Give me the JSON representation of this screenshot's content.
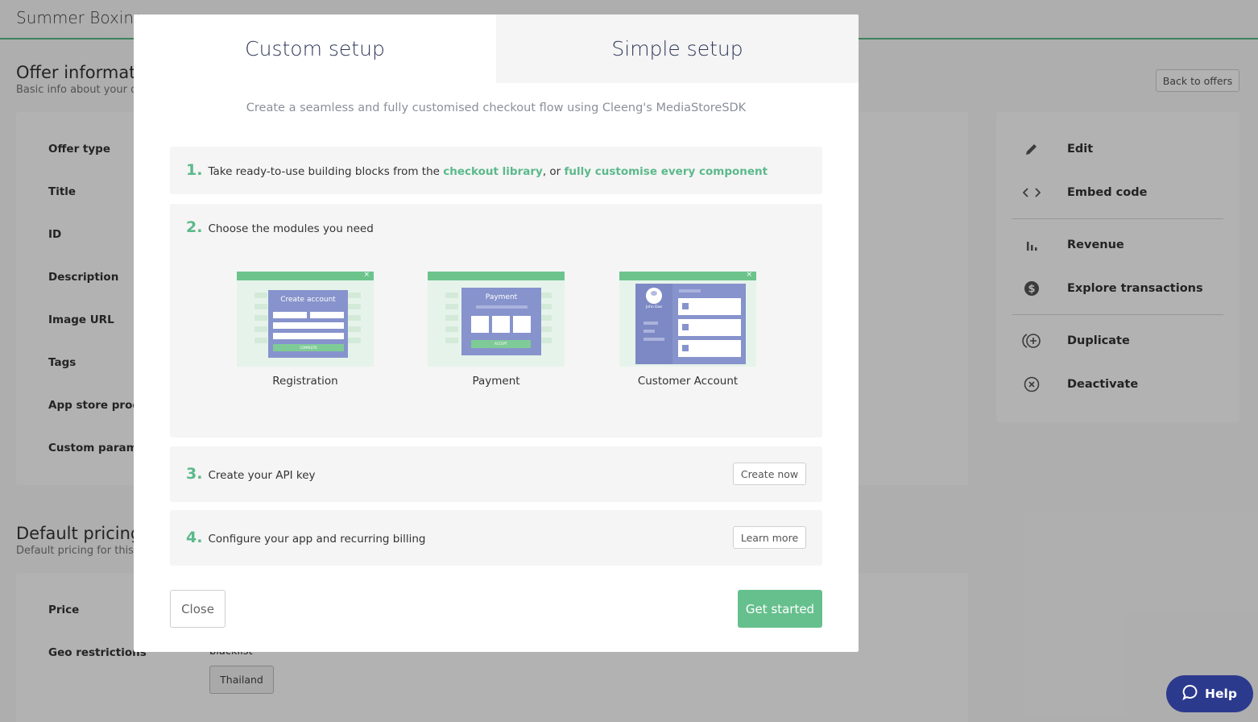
{
  "page": {
    "title": "Summer Boxing",
    "offer_section_title": "Offer information",
    "offer_section_sub": "Basic info about your offer",
    "back_button": "Back to offers",
    "offer_fields": [
      "Offer type",
      "Title",
      "ID",
      "Description",
      "Image URL",
      "Tags",
      "App store product",
      "Custom parameters"
    ],
    "pricing_section_title": "Default pricing",
    "pricing_section_sub": "Default pricing for this offer",
    "pricing_fields": [
      "Price",
      "Geo restrictions"
    ],
    "geo_mode": "blacklist",
    "geo_country": "Thailand",
    "accent_color": "#5bb98a"
  },
  "side_menu": {
    "items": [
      {
        "label": "Edit",
        "icon": "pencil-icon"
      },
      {
        "label": "Embed code",
        "icon": "code-icon"
      },
      {
        "label": "Revenue",
        "icon": "bar-chart-icon"
      },
      {
        "label": "Explore transactions",
        "icon": "dollar-circle-icon"
      },
      {
        "label": "Duplicate",
        "icon": "duplicate-plus-icon"
      },
      {
        "label": "Deactivate",
        "icon": "x-circle-icon"
      }
    ]
  },
  "help": {
    "label": "Help",
    "icon": "chat-bubble-icon"
  },
  "modal": {
    "tabs": [
      {
        "label": "Custom setup",
        "active": true
      },
      {
        "label": "Simple setup",
        "active": false
      }
    ],
    "intro": "Create a seamless and fully customised checkout flow using Cleeng's MediaStoreSDK",
    "step1": {
      "num": "1.",
      "text_before": "Take ready-to-use building blocks from the ",
      "link1": "checkout library",
      "text_middle": ", or ",
      "link2": "fully customise every component"
    },
    "step2": {
      "num": "2.",
      "text": "Choose the modules you need",
      "modules": [
        {
          "label": "Registration",
          "panel_title": "Create account",
          "panel_button": "COMPLETE"
        },
        {
          "label": "Payment",
          "panel_title": "Payment",
          "panel_button": "ACCEPT"
        },
        {
          "label": "Customer Account",
          "panel_user": "John Doe"
        }
      ]
    },
    "step3": {
      "num": "3.",
      "text": "Create your API key",
      "button": "Create now"
    },
    "step4": {
      "num": "4.",
      "text": "Configure your app and recurring billing",
      "button": "Learn more"
    },
    "close_button": "Close",
    "start_button": "Get started"
  }
}
